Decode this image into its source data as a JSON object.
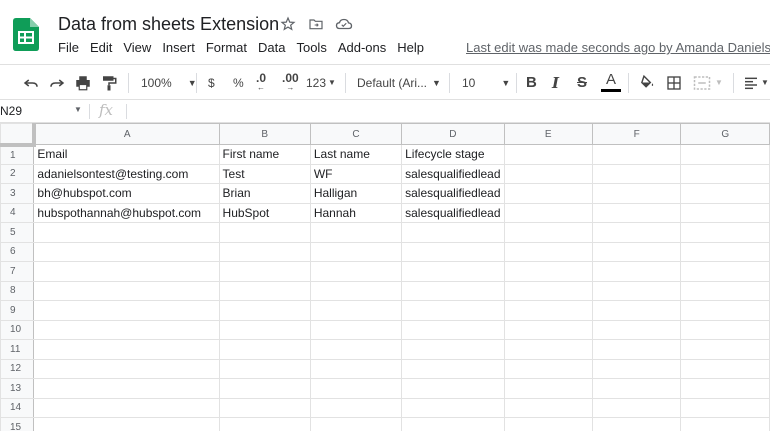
{
  "header": {
    "title": "Data from sheets Extension",
    "last_edit": "Last edit was made seconds ago by Amanda Danielson"
  },
  "menu": [
    "File",
    "Edit",
    "View",
    "Insert",
    "Format",
    "Data",
    "Tools",
    "Add-ons",
    "Help"
  ],
  "toolbar": {
    "zoom": "100%",
    "currency": "$",
    "percent": "%",
    "decimal_decrease": ".0",
    "decimal_increase": ".00",
    "more_formats": "123",
    "font": "Default (Ari...",
    "font_size": "10",
    "bold": "B",
    "italic": "I",
    "strike": "S",
    "text_color": "A",
    "text_color_bar": "#000000"
  },
  "formula_bar": {
    "cell_ref": "N29",
    "fx": "fx"
  },
  "grid": {
    "columns": [
      "A",
      "B",
      "C",
      "D",
      "E",
      "F",
      "G"
    ],
    "row_numbers": [
      "1",
      "2",
      "3",
      "4",
      "5",
      "6",
      "7",
      "8",
      "9",
      "10",
      "11",
      "12",
      "13",
      "14",
      "15"
    ],
    "rows": [
      [
        "Email",
        "First name",
        "Last name",
        "Lifecycle stage",
        "",
        "",
        ""
      ],
      [
        "adanielsontest@testing.com",
        "Test",
        "WF",
        "salesqualifiedlead",
        "",
        "",
        ""
      ],
      [
        "bh@hubspot.com",
        "Brian",
        "Halligan",
        "salesqualifiedlead",
        "",
        "",
        ""
      ],
      [
        "hubspothannah@hubspot.com",
        "HubSpot",
        "Hannah",
        "salesqualifiedlead",
        "",
        "",
        ""
      ],
      [
        "",
        "",
        "",
        "",
        "",
        "",
        ""
      ],
      [
        "",
        "",
        "",
        "",
        "",
        "",
        ""
      ],
      [
        "",
        "",
        "",
        "",
        "",
        "",
        ""
      ],
      [
        "",
        "",
        "",
        "",
        "",
        "",
        ""
      ],
      [
        "",
        "",
        "",
        "",
        "",
        "",
        ""
      ],
      [
        "",
        "",
        "",
        "",
        "",
        "",
        ""
      ],
      [
        "",
        "",
        "",
        "",
        "",
        "",
        ""
      ],
      [
        "",
        "",
        "",
        "",
        "",
        "",
        ""
      ],
      [
        "",
        "",
        "",
        "",
        "",
        "",
        ""
      ],
      [
        "",
        "",
        "",
        "",
        "",
        "",
        ""
      ],
      [
        "",
        "",
        "",
        "",
        "",
        "",
        ""
      ]
    ]
  },
  "colors": {
    "sheets_green": "#0f9d58",
    "grid_line": "#e2e2e2",
    "header_bg": "#f8f9fa"
  }
}
